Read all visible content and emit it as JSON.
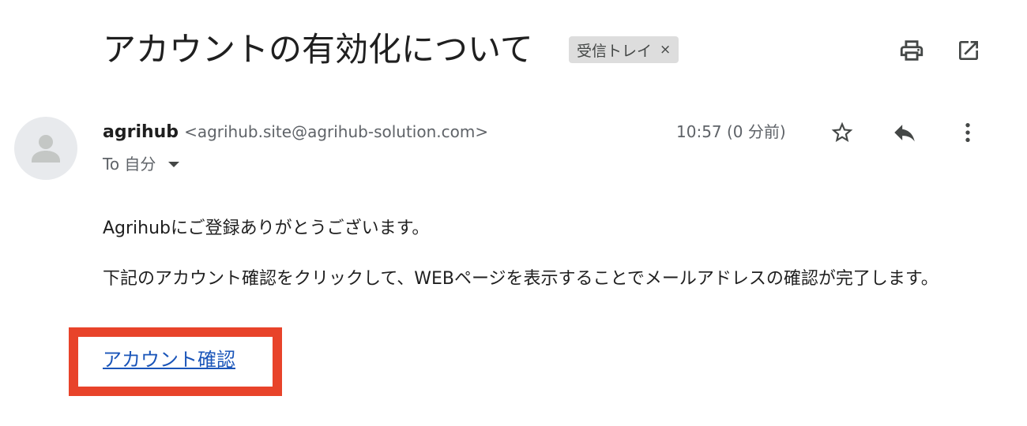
{
  "email": {
    "subject": "アカウントの有効化について",
    "label": "受信トレイ",
    "label_close": "×",
    "sender_name": "agrihub",
    "sender_email": "<agrihub.site@agrihub-solution.com>",
    "recipient": "To 自分",
    "timestamp": "10:57 (0 分前)",
    "body": {
      "greeting": "Agrihubにご登録ありがとうございます。",
      "instruction": "下記のアカウント確認をクリックして、WEBページを表示することでメールアドレスの確認が完了します。",
      "confirm_link": "アカウント確認"
    }
  },
  "icons": {
    "print": "print-icon",
    "popout": "open-in-new-icon",
    "star": "star-outline-icon",
    "reply": "reply-icon",
    "more": "more-vert-icon",
    "avatar": "person-icon"
  },
  "colors": {
    "link": "#1a55b9",
    "highlight_border": "#e8432a",
    "label_chip_bg": "#dddddd"
  }
}
